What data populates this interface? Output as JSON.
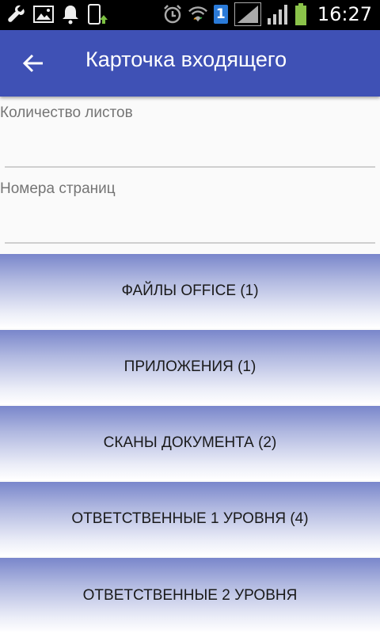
{
  "status_bar": {
    "time": "16:27",
    "sim_badge": "1",
    "icons": [
      "wrench-icon",
      "image-icon",
      "mute-bell-icon",
      "phone-sync-icon",
      "alarm-icon",
      "wifi-icon",
      "sim-badge-icon",
      "signal-icon",
      "signal-icon",
      "battery-icon"
    ]
  },
  "app_bar": {
    "title": "Карточка входящего",
    "back_icon": "arrow-back-icon"
  },
  "fields": {
    "sheets_count": {
      "label": "Количество листов",
      "value": ""
    },
    "page_numbers": {
      "label": "Номера страниц",
      "value": ""
    }
  },
  "buttons": {
    "office_files": "ФАЙЛЫ OFFICE (1)",
    "attachments": "ПРИЛОЖЕНИЯ (1)",
    "scans": "СКАНЫ ДОКУМЕНТА (2)",
    "responsible_level1": "ОТВЕТСТВЕННЫЕ 1 УРОВНЯ (4)",
    "responsible_level2": "ОТВЕТСТВЕННЫЕ 2 УРОВНЯ"
  },
  "colors": {
    "primary": "#3f51b5",
    "button_gradient_top": "#7986cb",
    "background": "#fafafa"
  }
}
